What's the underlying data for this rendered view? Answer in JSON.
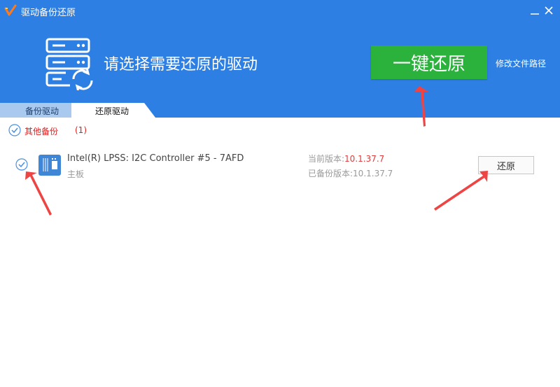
{
  "window": {
    "title": "驱动备份还原"
  },
  "hero": {
    "heading": "请选择需要还原的驱动",
    "restore_all_label": "一键还原",
    "path_link": "修改文件路径"
  },
  "tabs": [
    {
      "label": "备份驱动"
    },
    {
      "label": "还原驱动"
    }
  ],
  "group": {
    "label": "其他备份",
    "count": "(1)"
  },
  "driver": {
    "name": "Intel(R) LPSS: I2C Controller #5 - 7AFD",
    "category": "主板",
    "current_version_label": "当前版本:",
    "current_version": "10.1.37.7",
    "backup_version_label": "已备份版本:",
    "backup_version": "10.1.37.7",
    "restore_label": "还原"
  },
  "colors": {
    "header_bg": "#2e7fe3",
    "restore_all_bg": "#2ab23c",
    "accent_red": "#e23a3a",
    "annotation_arrow": "#ee4444"
  }
}
